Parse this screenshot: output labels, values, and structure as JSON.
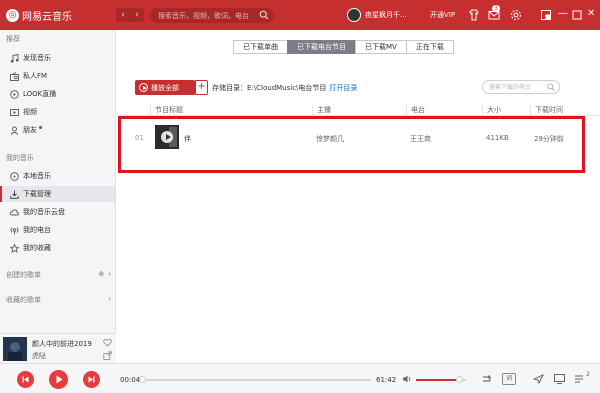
{
  "app": {
    "logo_text": "网易云音乐"
  },
  "search": {
    "placeholder": "搜索音乐，视频，歌词，电台"
  },
  "user": {
    "name": "夜星枫月千...",
    "vip_label": "开通VIP",
    "message_count": "3"
  },
  "sidebar": {
    "recommend_title": "推荐",
    "recommend_items": [
      {
        "label": "发现音乐",
        "icon": "music-note-icon"
      },
      {
        "label": "私人FM",
        "icon": "radio-icon"
      },
      {
        "label": "LOOK直播",
        "icon": "live-icon"
      },
      {
        "label": "视频",
        "icon": "video-icon"
      },
      {
        "label": "朋友",
        "icon": "friends-icon"
      }
    ],
    "mymusic_title": "我的音乐",
    "mymusic_items": [
      {
        "label": "本地音乐",
        "icon": "local-music-icon"
      },
      {
        "label": "下载管理",
        "icon": "download-icon",
        "active": true
      },
      {
        "label": "我的音乐云盘",
        "icon": "cloud-icon"
      },
      {
        "label": "我的电台",
        "icon": "podcast-icon"
      },
      {
        "label": "我的收藏",
        "icon": "star-icon"
      }
    ],
    "created_playlists": "创建的歌单",
    "collected_playlists": "收藏的歌单"
  },
  "now_playing": {
    "title": "颜人中的前进2019",
    "artist": "虎哒"
  },
  "tabs": [
    {
      "label": "已下载单曲",
      "active": false
    },
    {
      "label": "已下载电台节目",
      "active": true
    },
    {
      "label": "已下载MV",
      "active": false
    },
    {
      "label": "正在下载",
      "active": false
    }
  ],
  "toolbar": {
    "play_all": "播放全部",
    "add": "+",
    "storage_label": "存储目录：E:\\CloudMusic\\电台节目",
    "open_dir": "打开目录",
    "search_placeholder": "搜索下载的电台"
  },
  "table": {
    "headers": [
      "节目标题",
      "主播",
      "电台",
      "大小",
      "下载时间"
    ],
    "rows": [
      {
        "index": "01",
        "title": "伴",
        "host": "惊梦颜几",
        "station": "王王商",
        "size": "411KB",
        "time": "29分钟前"
      }
    ]
  },
  "player": {
    "current_time": "00:04",
    "total_time": "61:42",
    "progress": 0.001,
    "volume": 0.8,
    "lyric_label": "词",
    "queue_count": "2"
  },
  "colors": {
    "brand": "#c62f2f",
    "highlight_box": "#e0141e"
  }
}
